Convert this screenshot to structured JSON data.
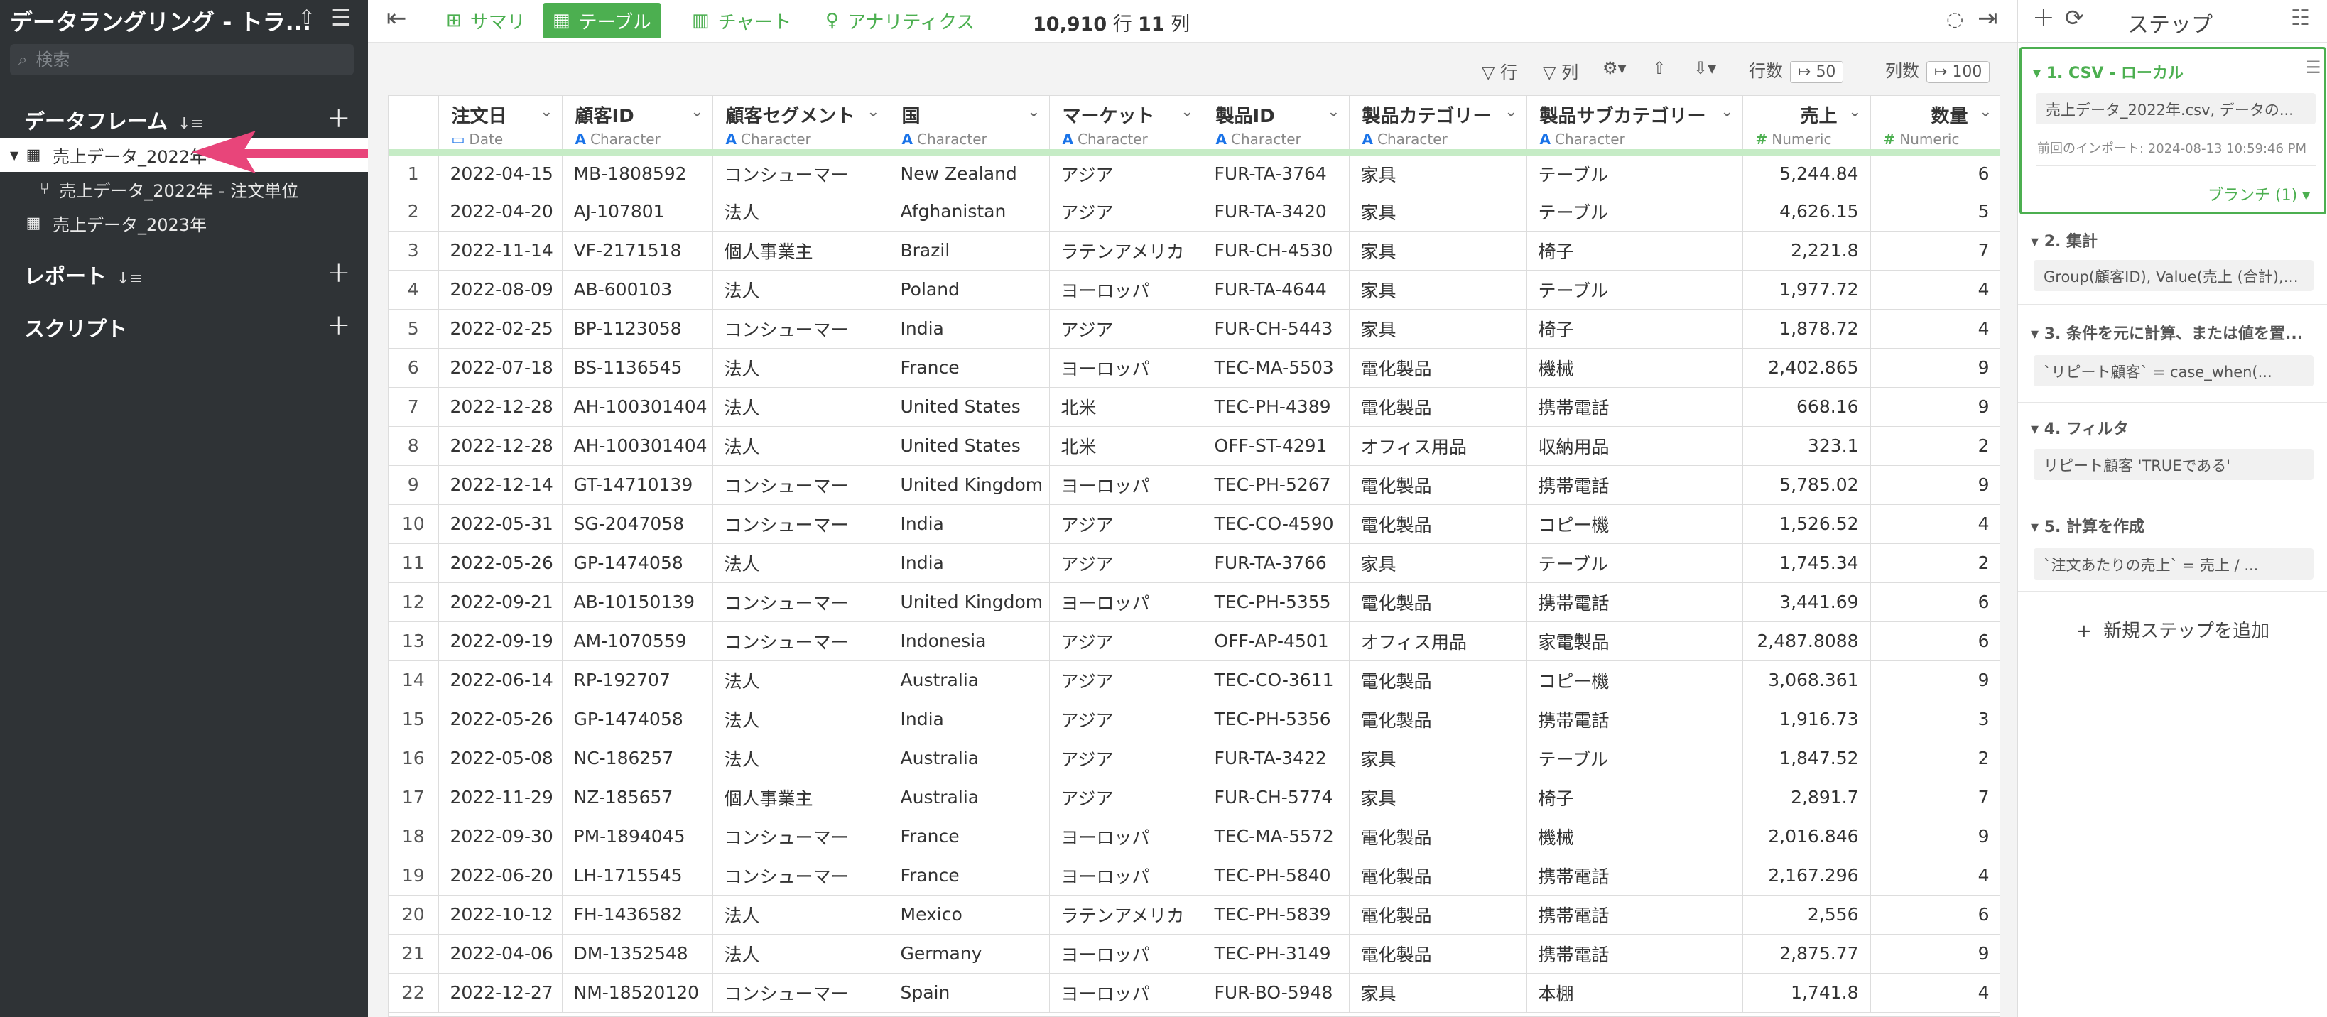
{
  "sidebar": {
    "title": "データラングリング - トラ...",
    "search_placeholder": "検索",
    "dataframes_label": "データフレーム",
    "reports_label": "レポート",
    "scripts_label": "スクリプト",
    "items": [
      {
        "label": "売上データ_2022年"
      },
      {
        "label": "売上データ_2022年 - 注文単位"
      },
      {
        "label": "売上データ_2023年"
      }
    ]
  },
  "toolbar": {
    "tabs": [
      "サマリ",
      "テーブル",
      "チャート",
      "アナリティクス"
    ],
    "rows": "10,910",
    "rows_unit": "行",
    "cols": "11",
    "cols_unit": "列"
  },
  "subbar": {
    "row_filter": "行",
    "col_filter": "列",
    "rows_label": "行数",
    "rows_value": "50",
    "cols_label": "列数",
    "cols_value": "100"
  },
  "table": {
    "columns": [
      {
        "name": "注文日",
        "type": "Date"
      },
      {
        "name": "顧客ID",
        "type": "Character"
      },
      {
        "name": "顧客セグメント",
        "type": "Character"
      },
      {
        "name": "国",
        "type": "Character"
      },
      {
        "name": "マーケット",
        "type": "Character"
      },
      {
        "name": "製品ID",
        "type": "Character"
      },
      {
        "name": "製品カテゴリー",
        "type": "Character"
      },
      {
        "name": "製品サブカテゴリー",
        "type": "Character"
      },
      {
        "name": "売上",
        "type": "Numeric"
      },
      {
        "name": "数量",
        "type": "Numeric"
      }
    ],
    "rows": [
      [
        "1",
        "2022-04-15",
        "MB-1808592",
        "コンシューマー",
        "New Zealand",
        "アジア",
        "FUR-TA-3764",
        "家具",
        "テーブル",
        "5,244.84",
        "6"
      ],
      [
        "2",
        "2022-04-20",
        "AJ-107801",
        "法人",
        "Afghanistan",
        "アジア",
        "FUR-TA-3420",
        "家具",
        "テーブル",
        "4,626.15",
        "5"
      ],
      [
        "3",
        "2022-11-14",
        "VF-2171518",
        "個人事業主",
        "Brazil",
        "ラテンアメリカ",
        "FUR-CH-4530",
        "家具",
        "椅子",
        "2,221.8",
        "7"
      ],
      [
        "4",
        "2022-08-09",
        "AB-600103",
        "法人",
        "Poland",
        "ヨーロッパ",
        "FUR-TA-4644",
        "家具",
        "テーブル",
        "1,977.72",
        "4"
      ],
      [
        "5",
        "2022-02-25",
        "BP-1123058",
        "コンシューマー",
        "India",
        "アジア",
        "FUR-CH-5443",
        "家具",
        "椅子",
        "1,878.72",
        "4"
      ],
      [
        "6",
        "2022-07-18",
        "BS-1136545",
        "法人",
        "France",
        "ヨーロッパ",
        "TEC-MA-5503",
        "電化製品",
        "機械",
        "2,402.865",
        "9"
      ],
      [
        "7",
        "2022-12-28",
        "AH-100301404",
        "法人",
        "United States",
        "北米",
        "TEC-PH-4389",
        "電化製品",
        "携帯電話",
        "668.16",
        "9"
      ],
      [
        "8",
        "2022-12-28",
        "AH-100301404",
        "法人",
        "United States",
        "北米",
        "OFF-ST-4291",
        "オフィス用品",
        "収納用品",
        "323.1",
        "2"
      ],
      [
        "9",
        "2022-12-14",
        "GT-14710139",
        "コンシューマー",
        "United Kingdom",
        "ヨーロッパ",
        "TEC-PH-5267",
        "電化製品",
        "携帯電話",
        "5,785.02",
        "9"
      ],
      [
        "10",
        "2022-05-31",
        "SG-2047058",
        "コンシューマー",
        "India",
        "アジア",
        "TEC-CO-4590",
        "電化製品",
        "コピー機",
        "1,526.52",
        "4"
      ],
      [
        "11",
        "2022-05-26",
        "GP-1474058",
        "法人",
        "India",
        "アジア",
        "FUR-TA-3766",
        "家具",
        "テーブル",
        "1,745.34",
        "2"
      ],
      [
        "12",
        "2022-09-21",
        "AB-10150139",
        "コンシューマー",
        "United Kingdom",
        "ヨーロッパ",
        "TEC-PH-5355",
        "電化製品",
        "携帯電話",
        "3,441.69",
        "6"
      ],
      [
        "13",
        "2022-09-19",
        "AM-1070559",
        "コンシューマー",
        "Indonesia",
        "アジア",
        "OFF-AP-4501",
        "オフィス用品",
        "家電製品",
        "2,487.8088",
        "6"
      ],
      [
        "14",
        "2022-06-14",
        "RP-192707",
        "法人",
        "Australia",
        "アジア",
        "TEC-CO-3611",
        "電化製品",
        "コピー機",
        "3,068.361",
        "9"
      ],
      [
        "15",
        "2022-05-26",
        "GP-1474058",
        "法人",
        "India",
        "アジア",
        "TEC-PH-5356",
        "電化製品",
        "携帯電話",
        "1,916.73",
        "3"
      ],
      [
        "16",
        "2022-05-08",
        "NC-186257",
        "法人",
        "Australia",
        "アジア",
        "FUR-TA-3422",
        "家具",
        "テーブル",
        "1,847.52",
        "2"
      ],
      [
        "17",
        "2022-11-29",
        "NZ-185657",
        "個人事業主",
        "Australia",
        "アジア",
        "FUR-CH-5774",
        "家具",
        "椅子",
        "2,891.7",
        "7"
      ],
      [
        "18",
        "2022-09-30",
        "PM-1894045",
        "コンシューマー",
        "France",
        "ヨーロッパ",
        "TEC-MA-5572",
        "電化製品",
        "機械",
        "2,016.846",
        "9"
      ],
      [
        "19",
        "2022-06-20",
        "LH-1715545",
        "コンシューマー",
        "France",
        "ヨーロッパ",
        "TEC-PH-5840",
        "電化製品",
        "携帯電話",
        "2,167.296",
        "4"
      ],
      [
        "20",
        "2022-10-12",
        "FH-1436582",
        "法人",
        "Mexico",
        "ラテンアメリカ",
        "TEC-PH-5839",
        "電化製品",
        "携帯電話",
        "2,556",
        "6"
      ],
      [
        "21",
        "2022-04-06",
        "DM-1352548",
        "法人",
        "Germany",
        "ヨーロッパ",
        "TEC-PH-3149",
        "電化製品",
        "携帯電話",
        "2,875.77",
        "9"
      ],
      [
        "22",
        "2022-12-27",
        "NM-18520120",
        "コンシューマー",
        "Spain",
        "ヨーロッパ",
        "FUR-BO-5948",
        "家具",
        "本棚",
        "1,741.8",
        "4"
      ]
    ]
  },
  "steps": {
    "title": "ステップ",
    "items": [
      {
        "title": "1. CSV - ローカル",
        "box": "売上データ_2022年.csv, データの...",
        "sub": "前回のインポート: 2024-08-13 10:59:46 PM",
        "branch": "ブランチ (1)"
      },
      {
        "title": "2. 集計",
        "box": "Group(顧客ID), Value(売上 (合計),数..."
      },
      {
        "title": "3. 条件を元に計算、または値を置...",
        "box": "`リピート顧客` = case_when(..."
      },
      {
        "title": "4. フィルタ",
        "box": "リピート顧客 'TRUEである'"
      },
      {
        "title": "5. 計算を作成",
        "box": "`注文あたりの売上` = 売上 / ..."
      }
    ],
    "add_label": "新規ステップを追加"
  },
  "colors": {
    "accent": "#4caf50",
    "sidebar_bg": "#2f3336",
    "arrow": "#e8457a",
    "type_char": "#1a73e8"
  }
}
